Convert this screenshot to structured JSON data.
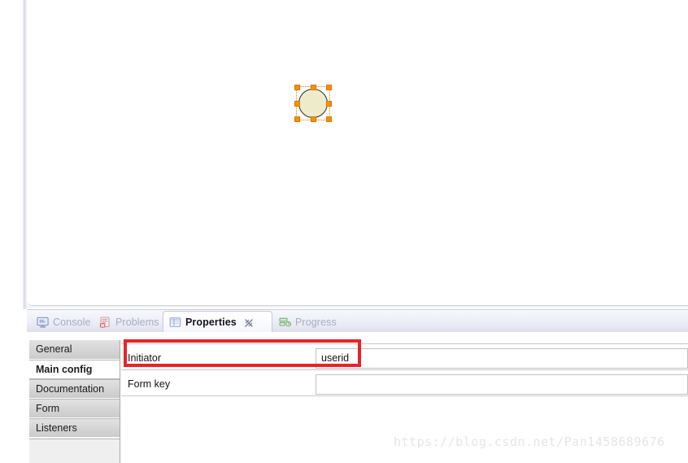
{
  "canvas": {
    "shape": {
      "name": "start-event",
      "fill_color": "#eeebcb",
      "stroke_color": "#2b2b2b",
      "selected": true,
      "handle_color": "#f59100"
    }
  },
  "tabbar": {
    "tabs": [
      {
        "label": "Console",
        "icon": "console-icon",
        "active": false,
        "closable": false
      },
      {
        "label": "Problems",
        "icon": "problems-icon",
        "active": false,
        "closable": false
      },
      {
        "label": "Properties",
        "icon": "properties-icon",
        "active": true,
        "closable": true
      },
      {
        "label": "Progress",
        "icon": "progress-icon",
        "active": false,
        "closable": false
      }
    ]
  },
  "properties": {
    "sidebar": {
      "items": [
        {
          "label": "General",
          "selected": false
        },
        {
          "label": "Main config",
          "selected": true
        },
        {
          "label": "Documentation",
          "selected": false
        },
        {
          "label": "Form",
          "selected": false
        },
        {
          "label": "Listeners",
          "selected": false
        }
      ]
    },
    "rows": [
      {
        "label": "Initiator",
        "value": "userid",
        "placeholder": ""
      },
      {
        "label": "Form key",
        "value": "",
        "placeholder": ""
      }
    ]
  },
  "annotation": {
    "highlight_color": "#e8232a"
  },
  "watermark": {
    "text": "https://blog.csdn.net/Pan1458689676"
  }
}
